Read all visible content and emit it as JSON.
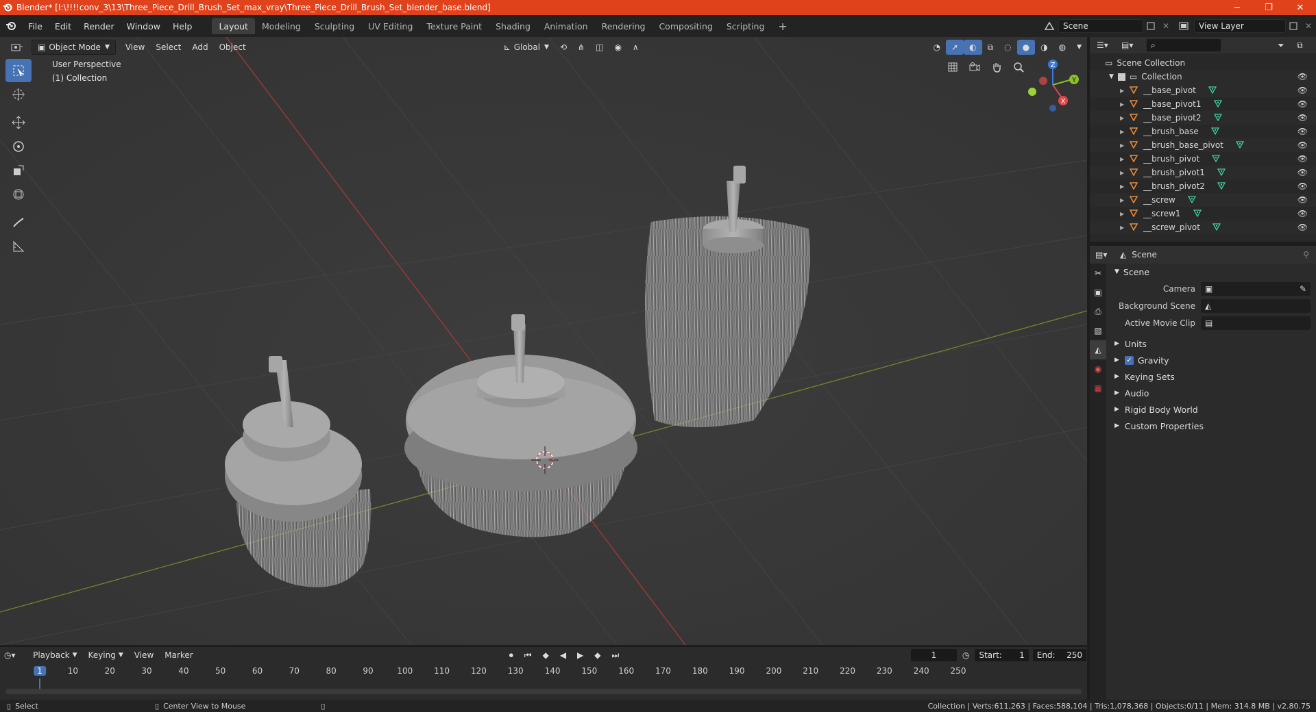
{
  "titlebar": {
    "title": "Blender* [I:\\!!!!conv_3\\13\\Three_Piece_Drill_Brush_Set_max_vray\\Three_Piece_Drill_Brush_Set_blender_base.blend]",
    "minimize": "─",
    "restore": "❐",
    "close": "✕"
  },
  "menu": [
    "File",
    "Edit",
    "Render",
    "Window",
    "Help"
  ],
  "workspaces": [
    "Layout",
    "Modeling",
    "Sculpting",
    "UV Editing",
    "Texture Paint",
    "Shading",
    "Animation",
    "Rendering",
    "Compositing",
    "Scripting"
  ],
  "workspace_add": "+",
  "scene_field": "Scene",
  "view_layer_field": "View Layer",
  "viewport": {
    "mode": "Object Mode",
    "menus": [
      "View",
      "Select",
      "Add",
      "Object"
    ],
    "transform_orientation": "Global",
    "perspective_label": "User Perspective",
    "collection_label": "(1) Collection",
    "gizmo": {
      "x": "X",
      "y": "Y",
      "z": "Z"
    }
  },
  "outliner": {
    "scene_collection": "Scene Collection",
    "collection": "Collection",
    "items": [
      "__base_pivot",
      "__base_pivot1",
      "__base_pivot2",
      "__brush_base",
      "__brush_base_pivot",
      "__brush_pivot",
      "__brush_pivot1",
      "__brush_pivot2",
      "__screw",
      "__screw1",
      "__screw_pivot"
    ]
  },
  "properties": {
    "header": "Scene",
    "panel": "Scene",
    "camera_label": "Camera",
    "background_scene_label": "Background Scene",
    "active_movie_clip_label": "Active Movie Clip",
    "subpanels": [
      "Units",
      "Gravity",
      "Keying Sets",
      "Audio",
      "Rigid Body World",
      "Custom Properties"
    ]
  },
  "timeline": {
    "menus": [
      "Playback",
      "Keying",
      "View",
      "Marker"
    ],
    "current_frame": "1",
    "start_label": "Start:",
    "start_value": "1",
    "end_label": "End:",
    "end_value": "250",
    "ticks": [
      "1",
      "10",
      "20",
      "30",
      "40",
      "50",
      "60",
      "70",
      "80",
      "90",
      "100",
      "110",
      "120",
      "130",
      "140",
      "150",
      "160",
      "170",
      "180",
      "190",
      "200",
      "210",
      "220",
      "230",
      "240",
      "250"
    ]
  },
  "statusbar": {
    "select": "Select",
    "center_view": "Center View to Mouse",
    "stats": "Collection | Verts:611,263 | Faces:588,104 | Tris:1,078,368 | Objects:0/11 | Mem: 314.8 MB | v2.80.75"
  },
  "colors": {
    "titlebar": "#e0421c",
    "accent": "#4772b3",
    "object_icon": "#e8893a",
    "mesh_icon": "#3fd1a0"
  }
}
